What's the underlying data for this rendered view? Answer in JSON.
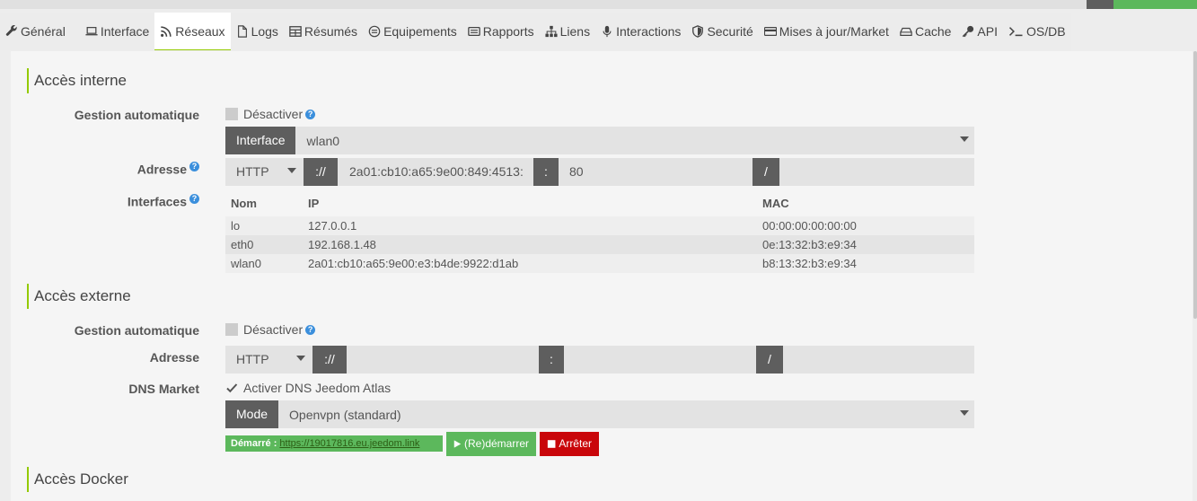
{
  "tabs": [
    {
      "label": "Général",
      "icon": "wrench-icon"
    },
    {
      "label": "Interface",
      "icon": "laptop-icon"
    },
    {
      "label": "Réseaux",
      "icon": "rss-icon"
    },
    {
      "label": "Logs",
      "icon": "file-icon"
    },
    {
      "label": "Résumés",
      "icon": "table-icon"
    },
    {
      "label": "Equipements",
      "icon": "connect-icon"
    },
    {
      "label": "Rapports",
      "icon": "report-icon"
    },
    {
      "label": "Liens",
      "icon": "sitemap-icon"
    },
    {
      "label": "Interactions",
      "icon": "microphone-icon"
    },
    {
      "label": "Securité",
      "icon": "shield-icon"
    },
    {
      "label": "Mises à jour/Market",
      "icon": "credit-card-icon"
    },
    {
      "label": "Cache",
      "icon": "hdd-icon"
    },
    {
      "label": "API",
      "icon": "key-icon"
    },
    {
      "label": "OS/DB",
      "icon": "terminal-icon"
    }
  ],
  "internal": {
    "title": "Accès interne",
    "auto_label": "Gestion automatique",
    "disable_label": "Désactiver",
    "interface_addon": "Interface",
    "interface_value": "wlan0",
    "address_label": "Adresse",
    "protocol": "HTTP",
    "separator_scheme": "://",
    "host": "2a01:cb10:a65:9e00:849:4513:",
    "separator_port": ":",
    "port": "80",
    "separator_path": "/",
    "interfaces_label": "Interfaces",
    "table_headers": [
      "Nom",
      "IP",
      "MAC"
    ],
    "rows": [
      {
        "name": "lo",
        "ip": "127.0.0.1",
        "mac": "00:00:00:00:00:00"
      },
      {
        "name": "eth0",
        "ip": "192.168.1.48",
        "mac": "0e:13:32:b3:e9:34"
      },
      {
        "name": "wlan0",
        "ip": "2a01:cb10:a65:9e00:e3:b4de:9922:d1ab",
        "mac": "b8:13:32:b3:e9:34"
      }
    ]
  },
  "external": {
    "title": "Accès externe",
    "auto_label": "Gestion automatique",
    "disable_label": "Désactiver",
    "address_label": "Adresse",
    "protocol": "HTTP",
    "separator_scheme": "://",
    "separator_port": ":",
    "separator_path": "/",
    "dns_label": "DNS Market",
    "dns_checkbox_label": "Activer DNS Jeedom Atlas",
    "mode_addon": "Mode",
    "mode_value": "Openvpn (standard)",
    "started_prefix": "Démarré :",
    "started_link": "https://19017816.eu.jeedom.link",
    "restart_label": "(Re)démarrer",
    "stop_label": "Arrêter"
  },
  "docker": {
    "title": "Accès Docker"
  },
  "colors": {
    "accent": "#93ca02",
    "addon": "#5e5e5e",
    "success": "#5cb85c",
    "danger": "#c9060a",
    "help": "#3b8fdc"
  }
}
